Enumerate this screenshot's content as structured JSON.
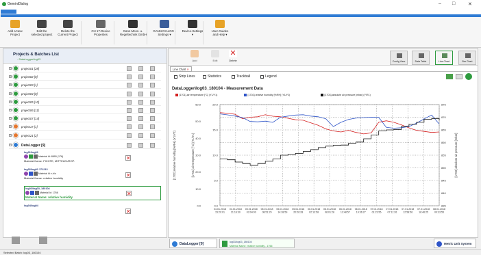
{
  "window": {
    "title": "GeminiDialog",
    "min": "–",
    "max": "□",
    "close": "✕"
  },
  "ribbon": {
    "buttons": [
      {
        "label": "Add a New\nProject",
        "icon": "folder-add-icon",
        "color": "#e7a327"
      },
      {
        "label": "Edit the\nselected project",
        "icon": "pencil-icon",
        "color": "#444444"
      },
      {
        "label": "Delete the\nCurrent Project",
        "icon": "trash-icon",
        "color": "#444444"
      },
      {
        "label": "CH 17-Device\nProperties",
        "icon": "device-icon",
        "color": "#666666"
      },
      {
        "label": "Gann Mess- u.\nRegeltechnik GmbH",
        "icon": "gann-logo-icon",
        "color": "#333333"
      },
      {
        "label": "GANN DIALOG -\nSettings ▾",
        "icon": "gear-icon",
        "color": "#3a5d9a"
      },
      {
        "label": "Device-Settings\n▾",
        "icon": "wrench-icon",
        "color": "#333333"
      },
      {
        "label": "User-Guides\nand Help ▾",
        "icon": "help-icon",
        "color": "#e7a327"
      }
    ]
  },
  "left": {
    "title": "Projects & Batches List",
    "subtitle": "- DataLogger/log03",
    "projects": [
      {
        "name": "project01 [28]",
        "color": "#2e9b3f"
      },
      {
        "name": "project02 [8]",
        "color": "#2e9b3f"
      },
      {
        "name": "project03 [1]",
        "color": "#2e9b3f"
      },
      {
        "name": "project04 [8]",
        "color": "#2e9b3f"
      },
      {
        "name": "project05 [10]",
        "color": "#2e9b3f"
      },
      {
        "name": "project06 [11]",
        "color": "#2e9b3f"
      },
      {
        "name": "project07 [14]",
        "color": "#2e9b3f"
      },
      {
        "name": "project17 [1]",
        "color": "#e5772e"
      },
      {
        "name": "project21 [2]",
        "color": "#e5772e"
      }
    ],
    "datalogger": {
      "name": "DataLogger [9]",
      "color": "#2f7bd4"
    },
    "batches": [
      {
        "id": "log01/log01",
        "material": "Material Name: FICHTE, MITTELEUROP.",
        "mat_code": "Material Id: 8890 (176)"
      },
      {
        "id": "log02/log02 171213",
        "material": "Material Name: relative humidity",
        "mat_code": "Material Id: r-h/o"
      },
      {
        "id": "log03/log03_180104",
        "material": "Material Name: relative humidity",
        "mat_code": "Material Id: 1766"
      },
      {
        "id": "log04/log04",
        "material": "",
        "mat_code": ""
      }
    ]
  },
  "toolbar": {
    "add": "Add",
    "edit": "Edit",
    "delete": "Delete",
    "views": [
      "Config View",
      "Data Table",
      "Line Chart",
      "Bar Chart"
    ]
  },
  "tab": "Line Chart",
  "options": {
    "strip": "Strip Lines",
    "stats": "Statistics",
    "track": "Trackball",
    "legend": "Legend"
  },
  "chart_data": {
    "type": "line",
    "title": "DataLogger\\log03_180104 - Measurement Data",
    "legend": [
      {
        "name": "[1701]-air temperature [°C] (Y1/Y1)",
        "color": "#d42020"
      },
      {
        "name": "[1702]-relative humidity [%RH] (Y1/Y2)",
        "color": "#2f55c8"
      },
      {
        "name": "[1703]-absolute air pressure [mbar] (Y/R1)",
        "color": "#111111"
      }
    ],
    "y_left_outer": {
      "label": "[1702] relative humidity [%RH] (Y1/Y2)",
      "ticks": [
        "0.0",
        "10.0",
        "20.0",
        "30.0",
        "40.0",
        "50.0",
        "60.0"
      ]
    },
    "y_left_inner": {
      "label": "[1701] air temperature [°C] (Y1/Y1)",
      "ticks": [
        "0.0",
        "5.0",
        "10.0",
        "15.0",
        "20.0"
      ]
    },
    "y_right": {
      "label": "[1703] absolute air pressure [mbar]",
      "ticks": [
        "835",
        "840",
        "845",
        "850",
        "855",
        "860",
        "865",
        "870",
        "875"
      ]
    },
    "x_ticks": [
      "04.01.2018\n15:29:01",
      "04.01.2018\n21:16:30",
      "05.01.2018\n03:04:00",
      "05.01.2018\n08:51:29",
      "05.01.2018\n14:38:59",
      "05.01.2018\n20:26:28",
      "06.01.2018\n02:13:58",
      "06.01.2018\n08:01:28",
      "06.01.2018\n13:48:57",
      "06.01.2018\n19:36:27",
      "07.01.2018\n01:23:56",
      "07.01.2018\n07:11:26",
      "07.01.2018\n12:58:56",
      "07.01.2018\n18:46:25",
      "08.01.2018\n00:33:55"
    ],
    "series": [
      {
        "name": "[1701]-air temperature [°C] (Y1/Y1)",
        "axis": "temp",
        "values": [
          18.4,
          18.3,
          18.1,
          17.2,
          17.5,
          17.6,
          18.0,
          17.7,
          17.6,
          17.3,
          17.0,
          16.9,
          16.4,
          15.9,
          15.2,
          14.8,
          14.6,
          14.9,
          14.5,
          14.2,
          14.4,
          16.5,
          16.8,
          16.5,
          16.0,
          15.4,
          14.9,
          14.7,
          14.5,
          14.6
        ]
      },
      {
        "name": "[1702]-relative humidity [%RH] (Y1/Y2)",
        "axis": "rh",
        "values": [
          54.5,
          53.9,
          53.2,
          52.3,
          50.0,
          49.8,
          50.2,
          49.5,
          52.5,
          53.2,
          53.8,
          54.0,
          53.2,
          52.8,
          51.6,
          47.0,
          49.5,
          51.2,
          52.0,
          52.3,
          52.5,
          52.4,
          46.5,
          46.0,
          46.3,
          47.0,
          49.0,
          51.5,
          53.8,
          48.5
        ]
      },
      {
        "name": "[1703]-absolute air pressure [mbar] (Y/R1)",
        "axis": "p",
        "values": [
          853.5,
          853.2,
          852.3,
          851.7,
          851.0,
          851.7,
          852.6,
          853.5,
          855.0,
          855.3,
          855.7,
          856.5,
          857.2,
          858.0,
          858.6,
          858.9,
          859.0,
          859.7,
          860.2,
          861.5,
          863.0,
          864.6,
          865.0,
          865.2,
          866.4,
          867.2,
          868.0,
          869.2,
          869.5,
          868.8
        ]
      }
    ]
  },
  "bottom": {
    "datalogger": "DataLogger [9]",
    "batch_id": "log03/log03_180104",
    "batch_mat": "Material Name: relative humidity - 1766",
    "units": "Metric Unit System"
  },
  "status": "Selected Batch: log03_180104"
}
